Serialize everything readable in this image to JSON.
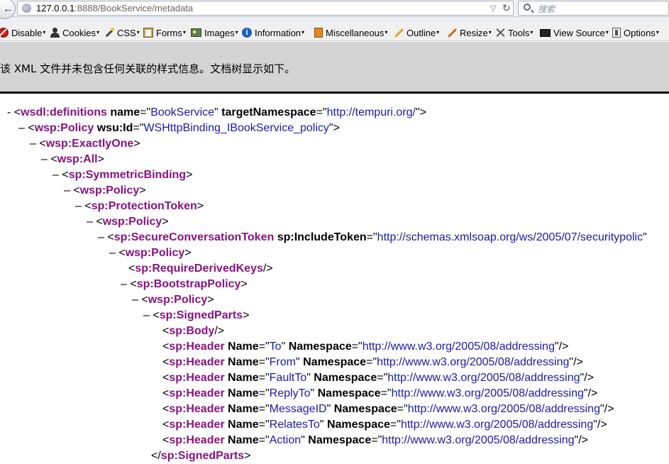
{
  "browser": {
    "url_host": "127.0.0.1",
    "url_rest": ":8888/BookService/metadata",
    "search_placeholder": "搜索"
  },
  "devtoolbar": {
    "items": [
      {
        "label": "Disable",
        "icon": "disable-icon"
      },
      {
        "label": "Cookies",
        "icon": "cookie-person-icon"
      },
      {
        "label": "CSS",
        "icon": "css-wand-icon"
      },
      {
        "label": "Forms",
        "icon": "clipboard-icon"
      },
      {
        "label": "Images",
        "icon": "image-icon"
      },
      {
        "label": "Information",
        "icon": "info-icon"
      },
      {
        "label": "Miscellaneous",
        "icon": "misc-book-icon"
      },
      {
        "label": "Outline",
        "icon": "pencil-icon"
      },
      {
        "label": "Resize",
        "icon": "resize-pencil-icon"
      },
      {
        "label": "Tools",
        "icon": "tools-icon"
      },
      {
        "label": "View Source",
        "icon": "monitor-icon"
      },
      {
        "label": "Options",
        "icon": "options-icon"
      }
    ]
  },
  "banner": {
    "text": "该 XML 文件并未包含任何关联的样式信息。文档树显示如下。"
  },
  "xml": {
    "lines": [
      {
        "indent": 0,
        "collapse": "-",
        "open": "<",
        "tag": "wsdl:definitions",
        "attrs": [
          {
            "n": "name",
            "v": "BookService"
          },
          {
            "n": "targetNamespace",
            "v": "http://tempuri.org/"
          }
        ],
        "close": ">"
      },
      {
        "indent": 1,
        "collapse": "–",
        "open": "<",
        "tag": "wsp:Policy",
        "attrs": [
          {
            "n": "wsu:Id",
            "v": "WSHttpBinding_IBookService_policy"
          }
        ],
        "close": ">"
      },
      {
        "indent": 2,
        "collapse": "–",
        "open": "<",
        "tag": "wsp:ExactlyOne",
        "attrs": [],
        "close": ">"
      },
      {
        "indent": 3,
        "collapse": "–",
        "open": "<",
        "tag": "wsp:All",
        "attrs": [],
        "close": ">"
      },
      {
        "indent": 4,
        "collapse": "–",
        "open": "<",
        "tag": "sp:SymmetricBinding",
        "attrs": [],
        "close": ">"
      },
      {
        "indent": 5,
        "collapse": "–",
        "open": "<",
        "tag": "wsp:Policy",
        "attrs": [],
        "close": ">"
      },
      {
        "indent": 6,
        "collapse": "–",
        "open": "<",
        "tag": "sp:ProtectionToken",
        "attrs": [],
        "close": ">"
      },
      {
        "indent": 7,
        "collapse": "–",
        "open": "<",
        "tag": "wsp:Policy",
        "attrs": [],
        "close": ">"
      },
      {
        "indent": 8,
        "collapse": "–",
        "open": "<",
        "tag": "sp:SecureConversationToken",
        "attrs": [
          {
            "n": "sp:IncludeToken",
            "v": "http://schemas.xmlsoap.org/ws/2005/07/securitypolic"
          }
        ],
        "close": ""
      },
      {
        "indent": 9,
        "collapse": "–",
        "open": "<",
        "tag": "wsp:Policy",
        "attrs": [],
        "close": ">"
      },
      {
        "indent": 10,
        "collapse": "",
        "open": "<",
        "tag": "sp:RequireDerivedKeys",
        "attrs": [],
        "close": "/>"
      },
      {
        "indent": 10,
        "collapse": "–",
        "open": "<",
        "tag": "sp:BootstrapPolicy",
        "attrs": [],
        "close": ">"
      },
      {
        "indent": 11,
        "collapse": "–",
        "open": "<",
        "tag": "wsp:Policy",
        "attrs": [],
        "close": ">"
      },
      {
        "indent": 12,
        "collapse": "–",
        "open": "<",
        "tag": "sp:SignedParts",
        "attrs": [],
        "close": ">"
      },
      {
        "indent": 13,
        "collapse": "",
        "open": "<",
        "tag": "sp:Body",
        "attrs": [],
        "close": "/>"
      },
      {
        "indent": 13,
        "collapse": "",
        "open": "<",
        "tag": "sp:Header",
        "attrs": [
          {
            "n": "Name",
            "v": "To"
          },
          {
            "n": "Namespace",
            "v": "http://www.w3.org/2005/08/addressing"
          }
        ],
        "close": "/>"
      },
      {
        "indent": 13,
        "collapse": "",
        "open": "<",
        "tag": "sp:Header",
        "attrs": [
          {
            "n": "Name",
            "v": "From"
          },
          {
            "n": "Namespace",
            "v": "http://www.w3.org/2005/08/addressing"
          }
        ],
        "close": "/>"
      },
      {
        "indent": 13,
        "collapse": "",
        "open": "<",
        "tag": "sp:Header",
        "attrs": [
          {
            "n": "Name",
            "v": "FaultTo"
          },
          {
            "n": "Namespace",
            "v": "http://www.w3.org/2005/08/addressing"
          }
        ],
        "close": "/>"
      },
      {
        "indent": 13,
        "collapse": "",
        "open": "<",
        "tag": "sp:Header",
        "attrs": [
          {
            "n": "Name",
            "v": "ReplyTo"
          },
          {
            "n": "Namespace",
            "v": "http://www.w3.org/2005/08/addressing"
          }
        ],
        "close": "/>"
      },
      {
        "indent": 13,
        "collapse": "",
        "open": "<",
        "tag": "sp:Header",
        "attrs": [
          {
            "n": "Name",
            "v": "MessageID"
          },
          {
            "n": "Namespace",
            "v": "http://www.w3.org/2005/08/addressing"
          }
        ],
        "close": "/>"
      },
      {
        "indent": 13,
        "collapse": "",
        "open": "<",
        "tag": "sp:Header",
        "attrs": [
          {
            "n": "Name",
            "v": "RelatesTo"
          },
          {
            "n": "Namespace",
            "v": "http://www.w3.org/2005/08/addressing"
          }
        ],
        "close": "/>"
      },
      {
        "indent": 13,
        "collapse": "",
        "open": "<",
        "tag": "sp:Header",
        "attrs": [
          {
            "n": "Name",
            "v": "Action"
          },
          {
            "n": "Namespace",
            "v": "http://www.w3.org/2005/08/addressing"
          }
        ],
        "close": "/>"
      },
      {
        "indent": 12,
        "collapse": "",
        "open": "</",
        "tag": "sp:SignedParts",
        "attrs": [],
        "close": ">"
      }
    ]
  },
  "colors": {
    "tag": "#881280",
    "attr_value": "#1a1aa6",
    "banner_bg": "#d4d4d4"
  }
}
